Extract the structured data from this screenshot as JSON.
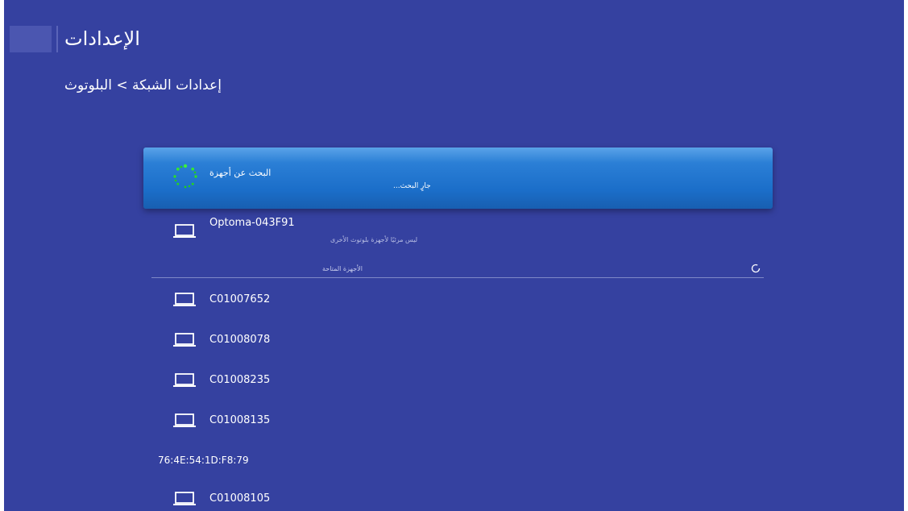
{
  "header": {
    "title": "الإعدادات"
  },
  "breadcrumb": {
    "text": "إعدادات الشبكة > البلوتوث"
  },
  "search": {
    "title": "البحث عن أجهزة",
    "subtitle": "جارٍ البحث...",
    "icon": "loading-spinner-icon"
  },
  "paired": {
    "device_name": "Optoma-043F91",
    "visibility_note": "ليس مرئيًا لأجهزة بلوتوث الأخرى",
    "icon": "laptop-icon"
  },
  "available": {
    "label": "الأجهزة المتاحة",
    "refresh_icon": "refresh-icon",
    "devices": [
      {
        "name": "C01007652",
        "icon": "laptop-icon"
      },
      {
        "name": "C01008078",
        "icon": "laptop-icon"
      },
      {
        "name": "C01008235",
        "icon": "laptop-icon"
      },
      {
        "name": "C01008135",
        "icon": "laptop-icon"
      },
      {
        "name": "76:4E:54:1D:F8:79",
        "icon": ""
      },
      {
        "name": "C01008105",
        "icon": "laptop-icon"
      }
    ]
  },
  "colors": {
    "background": "#3541a0",
    "selected_card": "#1b6ec9",
    "spinner": "#22dd22"
  }
}
